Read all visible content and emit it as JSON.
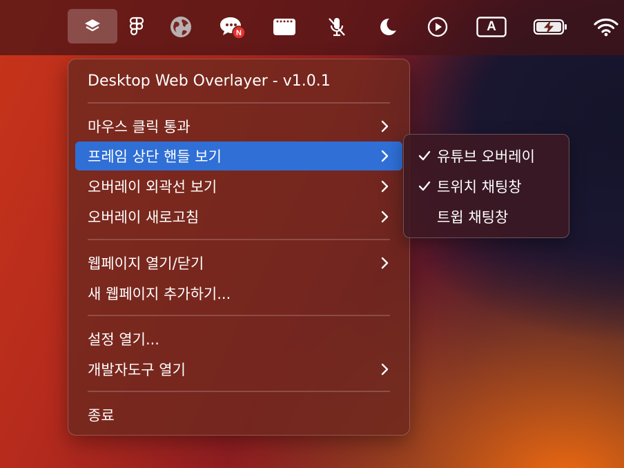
{
  "menubar": {
    "icons": [
      {
        "name": "layers-icon",
        "active": true
      },
      {
        "name": "figma-icon"
      },
      {
        "name": "globe-icon"
      },
      {
        "name": "messages-badge-icon",
        "badge": "N"
      },
      {
        "name": "window-icon"
      },
      {
        "name": "mic-muted-icon"
      },
      {
        "name": "moon-icon"
      },
      {
        "name": "play-circle-icon"
      },
      {
        "name": "input-source-icon",
        "label": "A"
      },
      {
        "name": "battery-charging-icon"
      },
      {
        "name": "wifi-icon"
      }
    ]
  },
  "menu": {
    "title": "Desktop Web Overlayer - v1.0.1",
    "items": [
      {
        "label": "마우스 클릭 통과",
        "submenu": true
      },
      {
        "label": "프레임 상단 핸들 보기",
        "submenu": true,
        "highlighted": true
      },
      {
        "label": "오버레이 외곽선 보기",
        "submenu": true
      },
      {
        "label": "오버레이 새로고침",
        "submenu": true
      },
      {
        "label": "웹페이지 열기/닫기",
        "submenu": true
      },
      {
        "label": "새 웹페이지 추가하기...",
        "submenu": false
      },
      {
        "label": "설정 열기...",
        "submenu": false
      },
      {
        "label": "개발자도구 열기",
        "submenu": true
      },
      {
        "label": "종료",
        "submenu": false
      }
    ]
  },
  "submenu": {
    "items": [
      {
        "label": "유튜브 오버레이",
        "checked": true
      },
      {
        "label": "트위치 채팅창",
        "checked": true
      },
      {
        "label": "트윕 채팅창",
        "checked": false
      }
    ]
  },
  "colors": {
    "highlight": "#2f6fd6",
    "badge": "#e5322d"
  }
}
